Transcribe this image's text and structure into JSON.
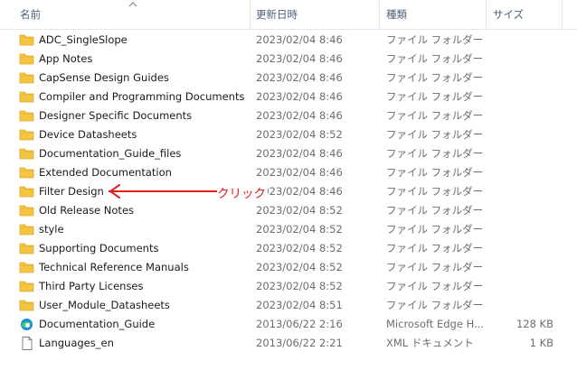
{
  "header": {
    "name": "名前",
    "date": "更新日時",
    "type": "種類",
    "size": "サイズ"
  },
  "annotation": {
    "label": "クリック",
    "color": "#e02020"
  },
  "colors": {
    "folder": "#f4c542",
    "folder_dark": "#e0a92a",
    "annotation_red": "#e02020"
  },
  "files": [
    {
      "icon": "folder-icon",
      "name": "ADC_SingleSlope",
      "date": "2023/02/04 8:46",
      "type": "ファイル フォルダー",
      "size": ""
    },
    {
      "icon": "folder-icon",
      "name": "App Notes",
      "date": "2023/02/04 8:46",
      "type": "ファイル フォルダー",
      "size": ""
    },
    {
      "icon": "folder-icon",
      "name": "CapSense Design Guides",
      "date": "2023/02/04 8:46",
      "type": "ファイル フォルダー",
      "size": ""
    },
    {
      "icon": "folder-icon",
      "name": "Compiler and Programming Documents",
      "date": "2023/02/04 8:46",
      "type": "ファイル フォルダー",
      "size": ""
    },
    {
      "icon": "folder-icon",
      "name": "Designer Specific Documents",
      "date": "2023/02/04 8:46",
      "type": "ファイル フォルダー",
      "size": ""
    },
    {
      "icon": "folder-icon",
      "name": "Device Datasheets",
      "date": "2023/02/04 8:52",
      "type": "ファイル フォルダー",
      "size": ""
    },
    {
      "icon": "folder-icon",
      "name": "Documentation_Guide_files",
      "date": "2023/02/04 8:46",
      "type": "ファイル フォルダー",
      "size": ""
    },
    {
      "icon": "folder-icon",
      "name": "Extended Documentation",
      "date": "2023/02/04 8:46",
      "type": "ファイル フォルダー",
      "size": ""
    },
    {
      "icon": "folder-icon",
      "name": "Filter Design",
      "date": "2023/02/04 8:46",
      "type": "ファイル フォルダー",
      "size": ""
    },
    {
      "icon": "folder-icon",
      "name": "Old Release Notes",
      "date": "2023/02/04 8:52",
      "type": "ファイル フォルダー",
      "size": ""
    },
    {
      "icon": "folder-icon",
      "name": "style",
      "date": "2023/02/04 8:52",
      "type": "ファイル フォルダー",
      "size": ""
    },
    {
      "icon": "folder-icon",
      "name": "Supporting Documents",
      "date": "2023/02/04 8:52",
      "type": "ファイル フォルダー",
      "size": ""
    },
    {
      "icon": "folder-icon",
      "name": "Technical Reference Manuals",
      "date": "2023/02/04 8:52",
      "type": "ファイル フォルダー",
      "size": ""
    },
    {
      "icon": "folder-icon",
      "name": "Third Party Licenses",
      "date": "2023/02/04 8:52",
      "type": "ファイル フォルダー",
      "size": ""
    },
    {
      "icon": "folder-icon",
      "name": "User_Module_Datasheets",
      "date": "2023/02/04 8:51",
      "type": "ファイル フォルダー",
      "size": ""
    },
    {
      "icon": "edge-icon",
      "name": "Documentation_Guide",
      "date": "2013/06/22 2:16",
      "type": "Microsoft Edge H...",
      "size": "128 KB"
    },
    {
      "icon": "document-icon",
      "name": "Languages_en",
      "date": "2013/06/22 2:21",
      "type": "XML ドキュメント",
      "size": "1 KB"
    }
  ]
}
